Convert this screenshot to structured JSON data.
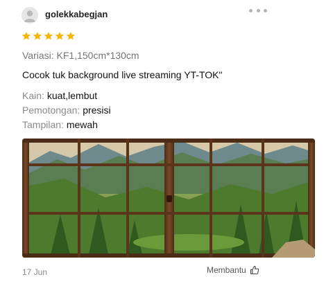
{
  "review": {
    "username": "golekkabegjan",
    "rating": 5,
    "variant": "Variasi: KF1,150cm*130cm",
    "comment": "Cocok tuk background live streaming YT-TOK\"",
    "attributes": [
      {
        "key": "Kain:",
        "value": "kuat,lembut"
      },
      {
        "key": "Pemotongan:",
        "value": "presisi"
      },
      {
        "key": "Tampilan:",
        "value": "mewah"
      }
    ],
    "date": "17 Jun",
    "helpful_label": "Membantu"
  },
  "icons": {
    "avatar": "user-avatar-icon",
    "more": "more-dots-icon",
    "star": "star-icon",
    "helpful": "thumbs-up-icon"
  },
  "colors": {
    "star": "#F5B400",
    "variant_text": "#757575",
    "attr_key": "#8A8A8A",
    "date": "#8A8A8A"
  }
}
